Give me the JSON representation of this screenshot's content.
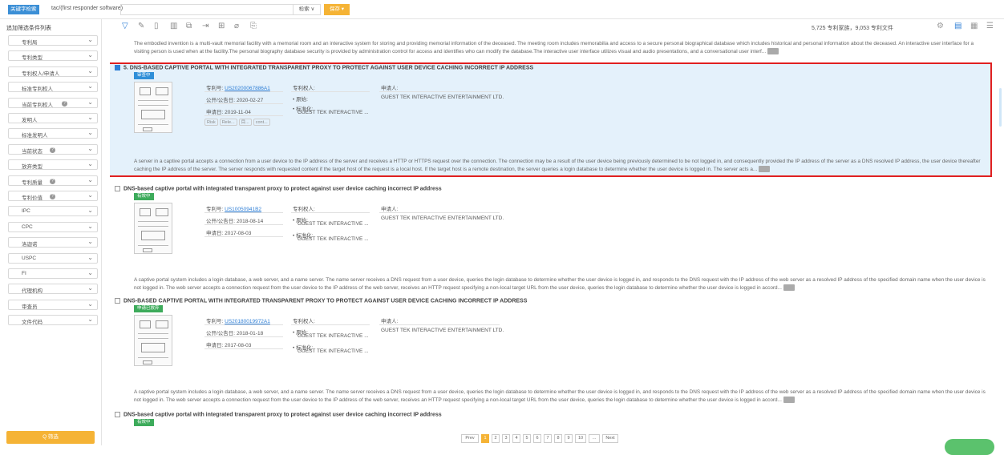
{
  "topbar": {
    "query_tag": "关键字检索",
    "query_text": "tac/(first responder software)",
    "search_dropdown": "检索 ∨",
    "save_button": "保存 ▾"
  },
  "sidebar": {
    "title": "追加筛选条件列表",
    "filter_button": "Q 筛选",
    "items": [
      {
        "label": "专利局",
        "help": false
      },
      {
        "label": "专利类型",
        "help": false
      },
      {
        "label": "专利权人/申请人",
        "help": false
      },
      {
        "label": "标准专利权人",
        "help": false
      },
      {
        "label": "当前专利权人",
        "help": true
      },
      {
        "label": "发明人",
        "help": false
      },
      {
        "label": "标准发明人",
        "help": false
      },
      {
        "label": "当前状态",
        "help": true
      },
      {
        "label": "放弃类型",
        "help": false
      },
      {
        "label": "专利质量",
        "help": true
      },
      {
        "label": "专利价值",
        "help": true
      },
      {
        "label": "IPC",
        "help": false
      },
      {
        "label": "CPC",
        "help": false
      },
      {
        "label": "洛迦诺",
        "help": false
      },
      {
        "label": "USPC",
        "help": false
      },
      {
        "label": "FI",
        "help": false
      },
      {
        "label": "代理机构",
        "help": false
      },
      {
        "label": "审查员",
        "help": false
      },
      {
        "label": "文件代码",
        "help": false
      }
    ]
  },
  "toolbar": {
    "counts": "5,725 专利家族，9,053 专利文件"
  },
  "top_abstract": "The embodied invention is a multi-vault memorial facility with a memorial room and an interactive system for storing and providing memorial information of the deceased. The meeting room includes memorabilia and access to a secure personal biographical database which includes historical and personal information about the deceased. An interactive user interface for a visiting person is used when at the facility.The personal biography database security is provided by administration control for access and identifies who can modify the database.The interactive user interface utilizes visual and audio presentations, and a conversational user interf...",
  "labels": {
    "pub_no": "专利号:",
    "pub_date": "公开/公告日:",
    "app_date": "申请日:",
    "assignee": "专利权人:",
    "applicant": "申请人:",
    "original": "• 原始:",
    "standard": "• 标准化:"
  },
  "results": [
    {
      "title": "5. DNS-BASED CAPTIVE PORTAL WITH INTEGRATED TRANSPARENT PROXY TO PROTECT AGAINST USER DEVICE CACHING INCORRECT IP ADDRESS",
      "status": "审查中",
      "status_color": "#2f8fd8",
      "pub_no": "US20200067886A1",
      "pub_date": "2020-02-27",
      "app_date": "2019-11-04",
      "applicant": "GUEST TEK INTERACTIVE ENTERTAINMENT LTD.",
      "assignee_std": "GUEST TEK INTERACTIVE ...",
      "chips": [
        "Risk",
        "Rele...",
        "目...",
        "cont..."
      ],
      "abstract": "A server in a captive portal accepts a connection from a user device to the IP address of the server and receives a HTTP or HTTPS request over the connection. The connection may be a result of the user device being previously determined to be not logged in, and consequently provided the IP address of the server as a DNS resolved IP address, the user device thereafter caching the IP address of the server. The server responds with requested content if the target host of the request is a local host. If the target host is a remote destination, the server queries a login database to determine whether the user device is logged in. The server acts a..."
    },
    {
      "title": "DNS-based captive portal with integrated transparent proxy to protect against user device caching incorrect IP address",
      "status": "有效中",
      "status_color": "#3dab5b",
      "pub_no": "US10050941B2",
      "pub_date": "2018-08-14",
      "app_date": "2017-08-03",
      "applicant": "GUEST TEK INTERACTIVE ENTERTAINMENT LTD.",
      "assignee_orig": "GUEST TEK INTERACTIVE ...",
      "assignee_std": "GUEST TEK INTERACTIVE ...",
      "abstract": "A captive portal system includes a login database, a web server, and a name server. The name server receives a DNS request from a user device, queries the login database to determine whether the user device is logged in, and responds to the DNS request with the IP address of the web server as a resolved IP address of the specified domain name when the user device is not logged in. The web server accepts a connection request from the user device to the IP address of the web server, receives an HTTP request specifying a non-local target URL from the user device, queries the login database to determine whether the user device is logged in accord..."
    },
    {
      "title": "DNS-BASED CAPTIVE PORTAL WITH INTEGRATED TRANSPARENT PROXY TO PROTECT AGAINST USER DEVICE CACHING INCORRECT IP ADDRESS",
      "status": "申请已放弃",
      "status_color": "#3dab5b",
      "pub_no": "US20180019972A1",
      "pub_date": "2018-01-18",
      "app_date": "2017-08-03",
      "applicant": "GUEST TEK INTERACTIVE ENTERTAINMENT LTD.",
      "assignee_orig": "GUEST TEK INTERACTIVE ...",
      "assignee_std": "GUEST TEK INTERACTIVE ...",
      "abstract": "A captive portal system includes a login database, a web server, and a name server. The name server receives a DNS request from a user device, queries the login database to determine whether the user device is logged in, and responds to the DNS request with the IP address of the web server as a resolved IP address of the specified domain name when the user device is not logged in. The web server accepts a connection request from the user device to the IP address of the web server, receives an HTTP request specifying a non-local target URL from the user device, queries the login database to determine whether the user device is logged in accord..."
    },
    {
      "title": "DNS-based captive portal with integrated transparent proxy to protect against user device caching incorrect IP address",
      "status": "有效中",
      "status_color": "#3dab5b"
    }
  ],
  "pager": {
    "prev": "Prev",
    "pages": [
      "1",
      "2",
      "3",
      "4",
      "5",
      "6",
      "7",
      "8",
      "9",
      "10",
      "..."
    ],
    "next": "Next",
    "current": "1"
  }
}
